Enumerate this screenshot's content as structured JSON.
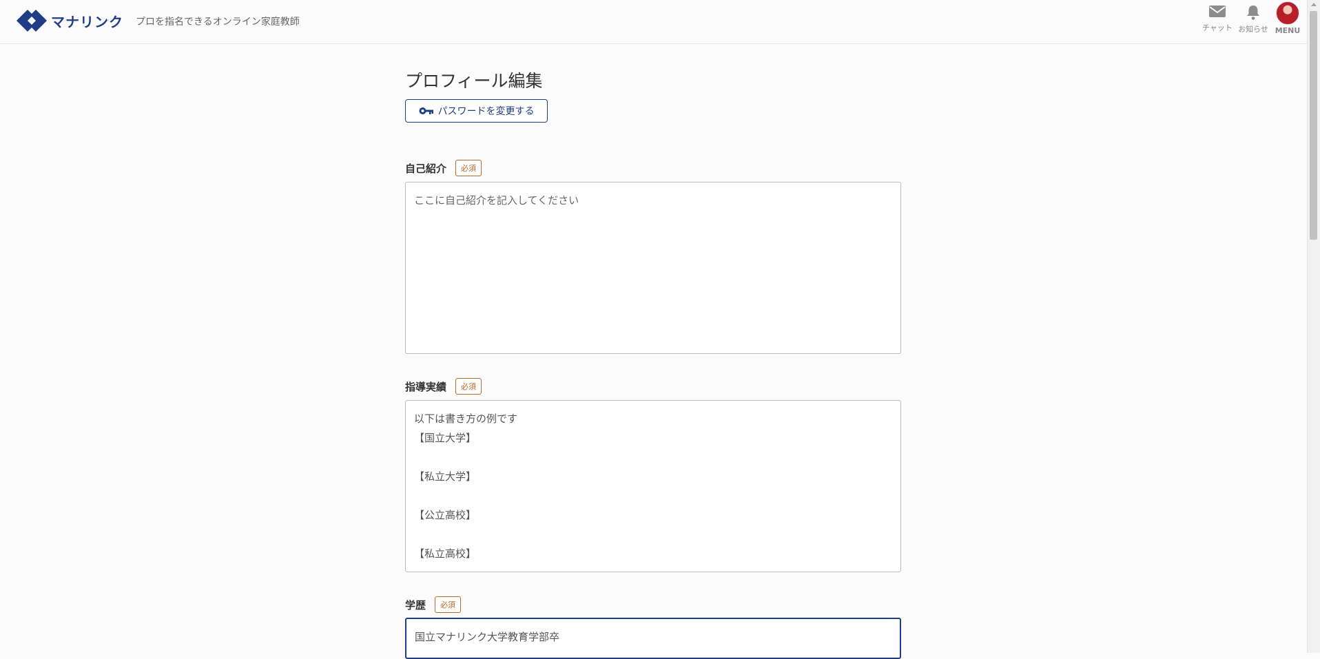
{
  "header": {
    "logo_text": "マナリンク",
    "tagline": "プロを指名できるオンライン家庭教師",
    "chat_label": "チャット",
    "notice_label": "お知らせ",
    "menu_label": "MENU"
  },
  "page": {
    "title": "プロフィール編集",
    "password_button": "パスワードを変更する"
  },
  "fields": {
    "intro": {
      "label": "自己紹介",
      "required": "必須",
      "placeholder": "ここに自己紹介を記入してください",
      "value": ""
    },
    "achievements": {
      "label": "指導実績",
      "required": "必須",
      "value": "以下は書き方の例です\n【国立大学】\n\n【私立大学】\n\n【公立高校】\n\n【私立高校】"
    },
    "education": {
      "label": "学歴",
      "required": "必須",
      "value": "国立マナリンク大学教育学部卒"
    }
  },
  "colors": {
    "brand": "#1f3d85",
    "required": "#b36a2e"
  }
}
